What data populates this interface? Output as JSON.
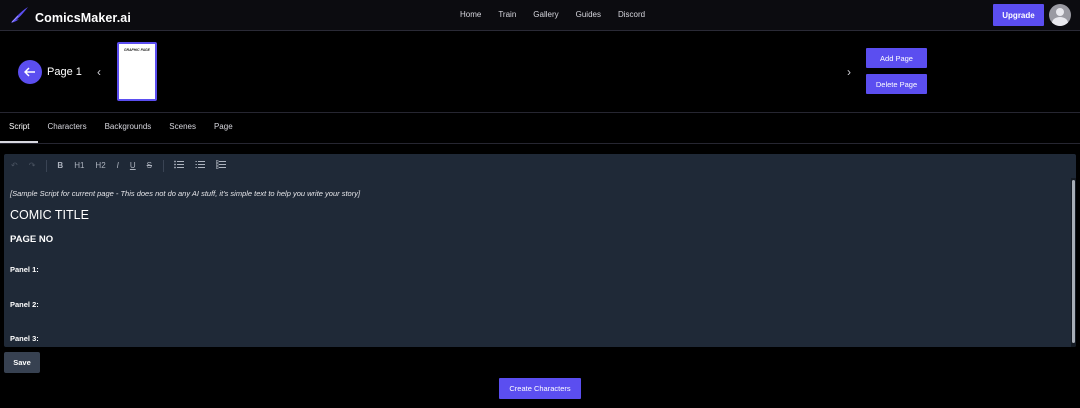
{
  "brand": {
    "name": "ComicsMaker.ai",
    "icon": "quill-icon",
    "accent": "#5b4ef0"
  },
  "nav": {
    "items": [
      {
        "label": "Home"
      },
      {
        "label": "Train"
      },
      {
        "label": "Gallery"
      },
      {
        "label": "Guides"
      },
      {
        "label": "Discord"
      }
    ],
    "upgrade_label": "Upgrade",
    "avatar_icon": "user-avatar-icon"
  },
  "page_bar": {
    "page_label": "Page 1",
    "prev_icon": "chevron-left-icon",
    "next_icon": "chevron-right-icon",
    "thumbnail_text": "GRAPHIC PAGE",
    "add_page_label": "Add Page",
    "delete_page_label": "Delete Page"
  },
  "tabs": [
    {
      "label": "Script",
      "active": true
    },
    {
      "label": "Characters",
      "active": false
    },
    {
      "label": "Backgrounds",
      "active": false
    },
    {
      "label": "Scenes",
      "active": false
    },
    {
      "label": "Page",
      "active": false
    }
  ],
  "toolbar": {
    "undo": "↶",
    "redo": "↷",
    "bold": "B",
    "h1": "H1",
    "h2": "H2",
    "italic": "I",
    "underline": "U",
    "strike": "S"
  },
  "editor": {
    "intro": "[Sample Script for current page - This does not do any AI stuff, it's simple text to help you write your story]",
    "title": "COMIC TITLE",
    "page_no": "PAGE NO",
    "panels": [
      "Panel 1:",
      "Panel 2:",
      "Panel 3:"
    ]
  },
  "actions": {
    "save_label": "Save",
    "create_characters_label": "Create Characters"
  }
}
